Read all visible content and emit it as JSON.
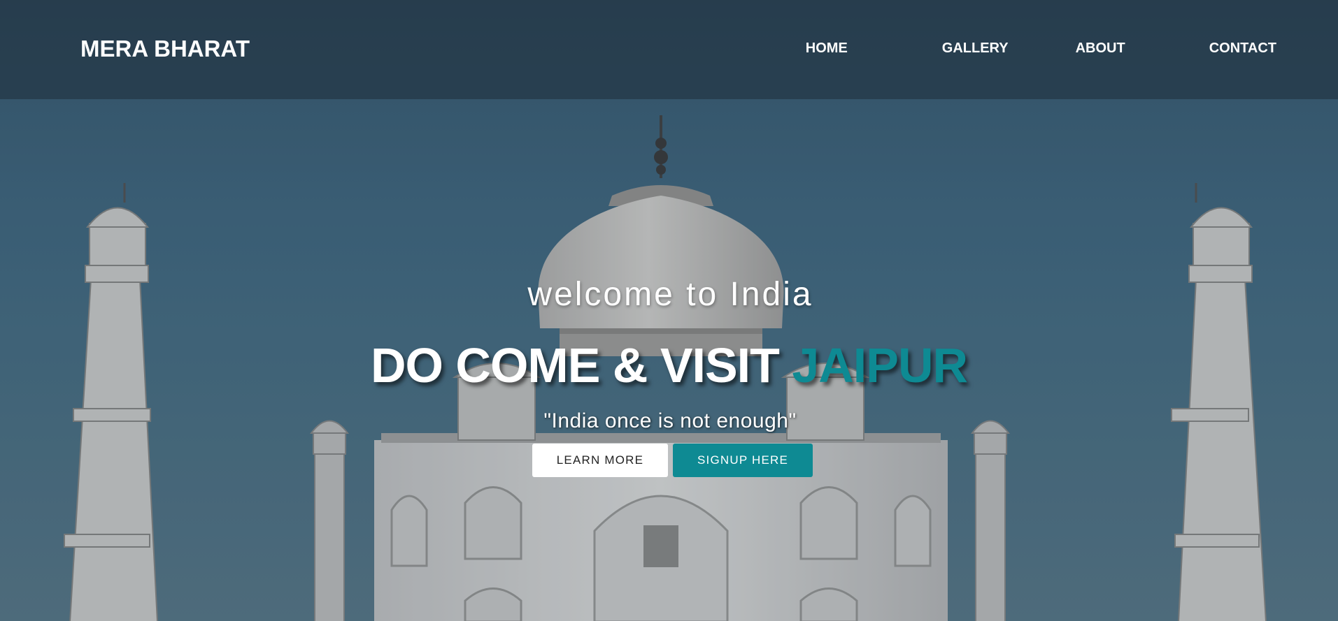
{
  "navbar": {
    "brand": "MERA BHARAT",
    "links": [
      {
        "label": "HOME"
      },
      {
        "label": "GALLERY"
      },
      {
        "label": "ABOUT"
      },
      {
        "label": "CONTACT"
      }
    ]
  },
  "hero": {
    "welcome": "welcome to India",
    "headline_main": "DO COME & VISIT",
    "headline_accent": "JAIPUR",
    "quote": "\"India once is not enough\"",
    "buttons": {
      "learn_more": "LEARN MORE",
      "signup": "SIGNUP HERE"
    },
    "background_image": "taj-mahal-photo"
  },
  "colors": {
    "accent": "#0e8a93",
    "navbar_overlay": "#1e2d3a",
    "sky": "#426a82"
  }
}
